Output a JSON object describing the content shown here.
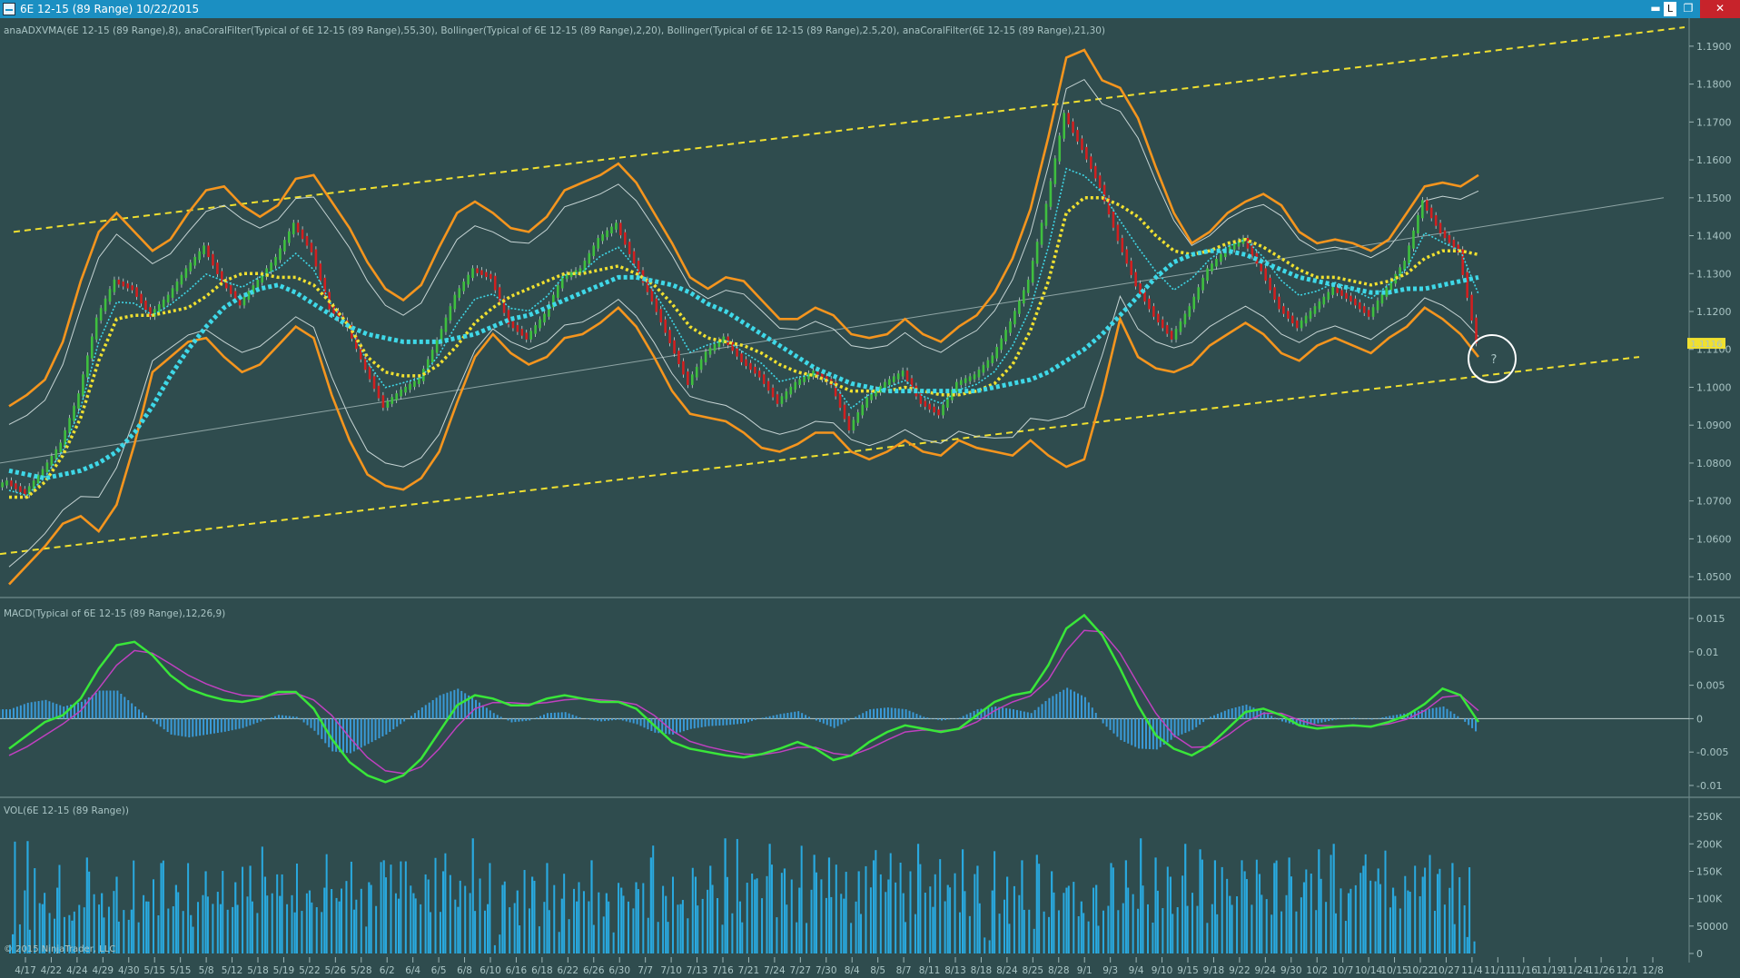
{
  "window": {
    "title": "6E 12-15 (89 Range)  10/22/2015",
    "link_label": "L",
    "minimize_glyph": "▬",
    "restore_glyph": "❐",
    "close_glyph": "✕"
  },
  "colors": {
    "background": "#2f4c4e",
    "titlebar": "#1b8fc2",
    "channel": "#f0e030",
    "bollinger": "#f5951e",
    "coral_fast": "#3fd8e8",
    "vma": "#f0e030",
    "macd_line": "#39e639",
    "macd_signal": "#c040c0",
    "macd_hist": "#3a9ad8",
    "volume": "#29a9df",
    "up_candle": "#3fbf3f",
    "down_candle": "#d02020"
  },
  "chart_data": [
    {
      "type": "line",
      "panel": "price",
      "label": "anaADXVMA(6E 12-15 (89 Range),8), anaCoralFilter(Typical of 6E 12-15 (89 Range),55,30), Bollinger(Typical of 6E 12-15 (89 Range),2,20), Bollinger(Typical of 6E 12-15 (89 Range),2.5,20), anaCoralFilter(6E 12-15 (89 Range),21,30)",
      "ylim": [
        1.045,
        1.195
      ],
      "yticks": [
        1.05,
        1.06,
        1.07,
        1.08,
        1.09,
        1.1,
        1.11,
        1.12,
        1.13,
        1.14,
        1.15,
        1.16,
        1.17,
        1.18,
        1.19
      ],
      "ytick_labels": [
        "1.0500",
        "1.0600",
        "1.0700",
        "1.0800",
        "1.0900",
        "1.1000",
        "1.1100",
        "1.1200",
        "1.1300",
        "1.1400",
        "1.1500",
        "1.1600",
        "1.1700",
        "1.1800",
        "1.1900"
      ],
      "last_price": "1.1116",
      "annotation": "?",
      "channel_upper": [
        [
          1.141,
          1.195
        ]
      ],
      "channel_lower": [
        [
          1.056,
          1.108
        ]
      ],
      "series": [
        {
          "role": "price",
          "values": [
            1.075,
            1.072,
            1.078,
            1.085,
            1.098,
            1.118,
            1.128,
            1.126,
            1.119,
            1.124,
            1.131,
            1.137,
            1.128,
            1.122,
            1.128,
            1.134,
            1.143,
            1.136,
            1.121,
            1.116,
            1.105,
            1.095,
            1.099,
            1.102,
            1.112,
            1.124,
            1.131,
            1.129,
            1.117,
            1.113,
            1.119,
            1.129,
            1.131,
            1.139,
            1.143,
            1.133,
            1.123,
            1.112,
            1.101,
            1.109,
            1.113,
            1.107,
            1.103,
            1.096,
            1.101,
            1.104,
            1.101,
            1.089,
            1.097,
            1.101,
            1.104,
            1.096,
            1.093,
            1.101,
            1.103,
            1.108,
            1.117,
            1.128,
            1.148,
            1.172,
            1.163,
            1.153,
            1.139,
            1.127,
            1.119,
            1.113,
            1.121,
            1.131,
            1.136,
            1.139,
            1.131,
            1.121,
            1.116,
            1.121,
            1.126,
            1.123,
            1.119,
            1.126,
            1.133,
            1.149,
            1.141,
            1.136,
            1.112
          ]
        },
        {
          "role": "bollinger_upper",
          "values": [
            1.095,
            1.098,
            1.102,
            1.112,
            1.128,
            1.141,
            1.146,
            1.141,
            1.136,
            1.139,
            1.146,
            1.152,
            1.153,
            1.148,
            1.145,
            1.148,
            1.155,
            1.156,
            1.149,
            1.142,
            1.133,
            1.126,
            1.123,
            1.127,
            1.137,
            1.146,
            1.149,
            1.146,
            1.142,
            1.141,
            1.145,
            1.152,
            1.154,
            1.156,
            1.159,
            1.154,
            1.146,
            1.138,
            1.129,
            1.126,
            1.129,
            1.128,
            1.123,
            1.118,
            1.118,
            1.121,
            1.119,
            1.114,
            1.113,
            1.114,
            1.118,
            1.114,
            1.112,
            1.116,
            1.119,
            1.125,
            1.134,
            1.147,
            1.166,
            1.187,
            1.189,
            1.181,
            1.179,
            1.171,
            1.158,
            1.146,
            1.138,
            1.141,
            1.146,
            1.149,
            1.151,
            1.148,
            1.141,
            1.138,
            1.139,
            1.138,
            1.136,
            1.139,
            1.146,
            1.153,
            1.154,
            1.153,
            1.156
          ]
        },
        {
          "role": "bollinger_lower",
          "values": [
            1.048,
            1.053,
            1.058,
            1.064,
            1.066,
            1.062,
            1.069,
            1.085,
            1.104,
            1.108,
            1.112,
            1.113,
            1.108,
            1.104,
            1.106,
            1.111,
            1.116,
            1.113,
            1.098,
            1.086,
            1.077,
            1.074,
            1.073,
            1.076,
            1.083,
            1.096,
            1.108,
            1.114,
            1.109,
            1.106,
            1.108,
            1.113,
            1.114,
            1.117,
            1.121,
            1.116,
            1.108,
            1.099,
            1.093,
            1.092,
            1.091,
            1.088,
            1.084,
            1.083,
            1.085,
            1.088,
            1.088,
            1.083,
            1.081,
            1.083,
            1.086,
            1.083,
            1.082,
            1.086,
            1.084,
            1.083,
            1.082,
            1.086,
            1.082,
            1.079,
            1.081,
            1.098,
            1.118,
            1.108,
            1.105,
            1.104,
            1.106,
            1.111,
            1.114,
            1.117,
            1.114,
            1.109,
            1.107,
            1.111,
            1.113,
            1.111,
            1.109,
            1.113,
            1.116,
            1.121,
            1.118,
            1.114,
            1.108
          ]
        },
        {
          "role": "coral_55",
          "values": [
            1.078,
            1.077,
            1.076,
            1.077,
            1.078,
            1.08,
            1.083,
            1.088,
            1.095,
            1.103,
            1.11,
            1.116,
            1.121,
            1.124,
            1.126,
            1.127,
            1.125,
            1.122,
            1.119,
            1.116,
            1.114,
            1.113,
            1.112,
            1.112,
            1.112,
            1.113,
            1.114,
            1.116,
            1.118,
            1.119,
            1.121,
            1.123,
            1.125,
            1.127,
            1.129,
            1.129,
            1.128,
            1.127,
            1.125,
            1.122,
            1.12,
            1.117,
            1.114,
            1.111,
            1.108,
            1.105,
            1.103,
            1.101,
            1.1,
            1.099,
            1.099,
            1.099,
            1.099,
            1.099,
            1.099,
            1.1,
            1.101,
            1.102,
            1.104,
            1.107,
            1.11,
            1.114,
            1.119,
            1.124,
            1.129,
            1.133,
            1.135,
            1.136,
            1.136,
            1.135,
            1.133,
            1.131,
            1.129,
            1.128,
            1.127,
            1.126,
            1.125,
            1.125,
            1.126,
            1.126,
            1.127,
            1.128,
            1.129
          ]
        },
        {
          "role": "vma",
          "values": [
            1.071,
            1.071,
            1.075,
            1.082,
            1.092,
            1.107,
            1.118,
            1.119,
            1.119,
            1.12,
            1.121,
            1.124,
            1.128,
            1.13,
            1.13,
            1.129,
            1.129,
            1.127,
            1.122,
            1.116,
            1.108,
            1.104,
            1.103,
            1.103,
            1.106,
            1.111,
            1.117,
            1.121,
            1.124,
            1.126,
            1.128,
            1.13,
            1.13,
            1.131,
            1.132,
            1.13,
            1.127,
            1.122,
            1.116,
            1.113,
            1.112,
            1.111,
            1.109,
            1.106,
            1.104,
            1.103,
            1.101,
            1.099,
            1.099,
            1.099,
            1.1,
            1.099,
            1.098,
            1.098,
            1.099,
            1.101,
            1.106,
            1.115,
            1.128,
            1.146,
            1.15,
            1.15,
            1.148,
            1.145,
            1.14,
            1.136,
            1.135,
            1.136,
            1.138,
            1.139,
            1.137,
            1.134,
            1.131,
            1.129,
            1.129,
            1.128,
            1.127,
            1.128,
            1.13,
            1.134,
            1.136,
            1.136,
            1.135
          ]
        }
      ]
    },
    {
      "type": "bar+line",
      "panel": "macd",
      "label": "MACD(Typical of 6E 12-15 (89 Range),12,26,9)",
      "ylim": [
        -0.0115,
        0.0165
      ],
      "yticks": [
        -0.01,
        -0.005,
        0,
        0.005,
        0.01,
        0.015
      ],
      "ytick_labels": [
        "-0.01",
        "-0.005",
        "0",
        "0.005",
        "0.01",
        "0.015"
      ],
      "series": [
        {
          "name": "MACD",
          "values": [
            -0.0045,
            -0.0025,
            -0.0005,
            0.0005,
            0.003,
            0.0075,
            0.011,
            0.0115,
            0.0095,
            0.0065,
            0.0045,
            0.0035,
            0.0028,
            0.0025,
            0.003,
            0.004,
            0.004,
            0.0015,
            -0.003,
            -0.0065,
            -0.0085,
            -0.0095,
            -0.0085,
            -0.006,
            -0.002,
            0.002,
            0.0035,
            0.003,
            0.002,
            0.002,
            0.003,
            0.0035,
            0.003,
            0.0025,
            0.0025,
            0.0015,
            -0.001,
            -0.0035,
            -0.0045,
            -0.005,
            -0.0055,
            -0.0058,
            -0.0053,
            -0.0045,
            -0.0035,
            -0.0045,
            -0.0062,
            -0.0055,
            -0.0035,
            -0.002,
            -0.001,
            -0.0015,
            -0.002,
            -0.0015,
            0.0005,
            0.0025,
            0.0035,
            0.004,
            0.008,
            0.0135,
            0.0155,
            0.0125,
            0.0075,
            0.002,
            -0.0025,
            -0.0045,
            -0.0055,
            -0.004,
            -0.0015,
            0.001,
            0.0015,
            0.0005,
            -0.001,
            -0.0015,
            -0.0012,
            -0.001,
            -0.0012,
            -0.0005,
            0.0005,
            0.0022,
            0.0045,
            0.0035,
            -0.0005
          ]
        },
        {
          "name": "Avg",
          "values": [
            -0.0055,
            -0.0042,
            -0.0025,
            -0.0008,
            0.0012,
            0.0045,
            0.008,
            0.0102,
            0.0098,
            0.0082,
            0.0065,
            0.0052,
            0.0042,
            0.0035,
            0.0033,
            0.0036,
            0.0038,
            0.0028,
            0.0005,
            -0.0028,
            -0.0058,
            -0.0078,
            -0.0082,
            -0.0072,
            -0.0045,
            -0.0012,
            0.0015,
            0.0024,
            0.0024,
            0.0022,
            0.0024,
            0.0028,
            0.003,
            0.0028,
            0.0026,
            0.0021,
            0.0005,
            -0.0018,
            -0.0034,
            -0.0042,
            -0.0048,
            -0.0053,
            -0.0054,
            -0.005,
            -0.0043,
            -0.0043,
            -0.0052,
            -0.0055,
            -0.0045,
            -0.0032,
            -0.002,
            -0.0017,
            -0.0018,
            -0.0016,
            -0.0005,
            0.0012,
            0.0025,
            0.0034,
            0.0058,
            0.0102,
            0.0132,
            0.013,
            0.0098,
            0.0052,
            0.0008,
            -0.0025,
            -0.0043,
            -0.0042,
            -0.0025,
            -0.0005,
            0.0008,
            0.0008,
            -0.0002,
            -0.001,
            -0.0011,
            -0.0011,
            -0.0011,
            -0.0008,
            -0.0001,
            0.0012,
            0.0032,
            0.0035,
            0.0012
          ]
        }
      ]
    },
    {
      "type": "bar",
      "panel": "volume",
      "label": "VOL(6E 12-15 (89 Range))",
      "ylim": [
        0,
        270000
      ],
      "yticks": [
        0,
        50000,
        100000,
        150000,
        200000,
        250000
      ],
      "ytick_labels": [
        "0",
        "50000",
        "100K",
        "150K",
        "200K",
        "250K"
      ],
      "values": [
        35000,
        205000,
        90000,
        120000,
        60000,
        175000,
        110000,
        140000,
        80000,
        95000,
        165000,
        125000,
        70000,
        150000,
        90000,
        130000,
        160000,
        140000,
        105000,
        75000,
        115000,
        120000,
        95000,
        80000,
        130000,
        170000,
        100000,
        110000,
        135000,
        150000,
        85000,
        210000,
        90000,
        125000,
        115000,
        140000,
        165000,
        100000,
        95000,
        170000,
        110000,
        120000,
        130000,
        175000,
        105000,
        90000,
        140000,
        160000,
        210000,
        95000,
        135000,
        200000,
        155000,
        120000,
        180000,
        175000,
        100000,
        150000,
        170000,
        135000,
        110000,
        200000,
        85000,
        125000,
        190000,
        160000,
        115000,
        140000,
        170000,
        180000,
        150000,
        120000,
        95000,
        125000,
        165000,
        170000,
        210000,
        175000,
        140000,
        200000,
        190000,
        170000,
        105000,
        150000,
        145000,
        165000,
        175000,
        130000,
        190000,
        200000,
        110000,
        160000,
        155000,
        120000,
        115000,
        140000,
        145000,
        165000,
        30000
      ]
    }
  ],
  "x_axis": {
    "labels": [
      "4/17",
      "4/22",
      "4/24",
      "4/29",
      "4/30",
      "5/15",
      "5/15",
      "5/8",
      "5/12",
      "5/18",
      "5/19",
      "5/22",
      "5/26",
      "5/28",
      "6/2",
      "6/4",
      "6/5",
      "6/8",
      "6/10",
      "6/16",
      "6/18",
      "6/22",
      "6/26",
      "6/30",
      "7/7",
      "7/10",
      "7/13",
      "7/16",
      "7/21",
      "7/24",
      "7/27",
      "7/30",
      "8/4",
      "8/5",
      "8/7",
      "8/11",
      "8/13",
      "8/18",
      "8/24",
      "8/25",
      "8/28",
      "9/1",
      "9/3",
      "9/4",
      "9/10",
      "9/15",
      "9/18",
      "9/22",
      "9/24",
      "9/30",
      "10/2",
      "10/7",
      "10/14",
      "10/15",
      "10/22",
      "10/27",
      "11/4",
      "11/11",
      "11/16",
      "11/19",
      "11/24",
      "11/26",
      "12/1",
      "12/8"
    ]
  },
  "watermark": "© 2015 NinjaTrader, LLC"
}
